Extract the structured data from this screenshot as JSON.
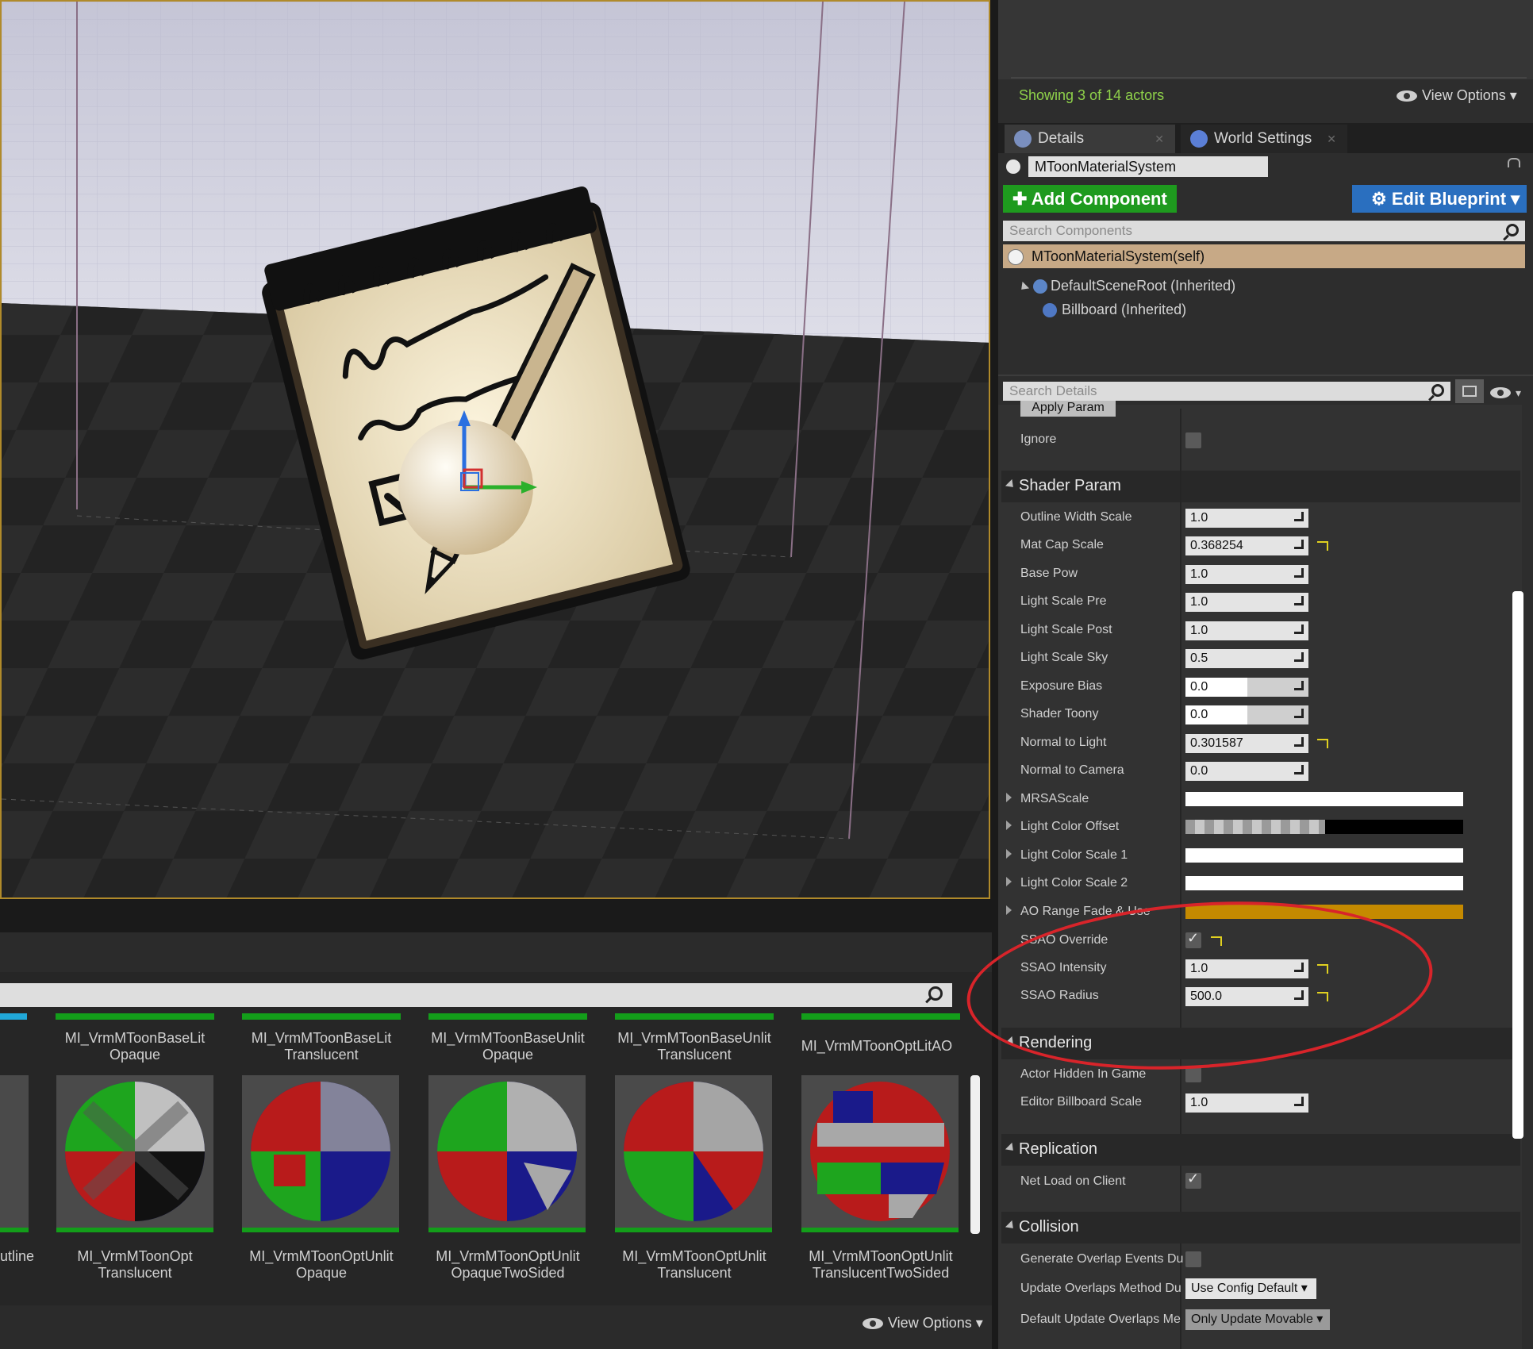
{
  "outliner": {
    "showing": "Showing 3 of 14 actors",
    "view_options": "View Options"
  },
  "tabs": [
    {
      "label": "Details"
    },
    {
      "label": "World Settings"
    }
  ],
  "actor_name": "MToonMaterialSystem",
  "buttons": {
    "add_component": "Add Component",
    "edit_blueprint": "Edit Blueprint"
  },
  "search_components_placeholder": "Search Components",
  "components": {
    "selected": "MToonMaterialSystem(self)",
    "root": "DefaultSceneRoot (Inherited)",
    "billboard": "Billboard (Inherited)"
  },
  "search_details_placeholder": "Search Details",
  "details": {
    "apply_param": "Apply Param",
    "ignore_label": "Ignore",
    "ignore_checked": false,
    "categories": {
      "shader_param": "Shader Param",
      "rendering": "Rendering",
      "replication": "Replication",
      "collision": "Collision"
    },
    "shader_params": [
      {
        "label": "Outline Width Scale",
        "value": "1.0"
      },
      {
        "label": "Mat Cap Scale",
        "value": "0.368254"
      },
      {
        "label": "Base Pow",
        "value": "1.0"
      },
      {
        "label": "Light Scale Pre",
        "value": "1.0"
      },
      {
        "label": "Light Scale Post",
        "value": "1.0"
      },
      {
        "label": "Light Scale Sky",
        "value": "0.5"
      },
      {
        "label": "Exposure Bias",
        "value": "0.0"
      },
      {
        "label": "Shader Toony",
        "value": "0.0"
      },
      {
        "label": "Normal to Light",
        "value": "0.301587"
      },
      {
        "label": "Normal to Camera",
        "value": "0.0"
      }
    ],
    "color_params": [
      {
        "label": "MRSAScale"
      },
      {
        "label": "Light Color Offset"
      },
      {
        "label": "Light Color Scale 1"
      },
      {
        "label": "Light Color Scale 2"
      },
      {
        "label": "AO Range Fade & Use"
      }
    ],
    "ssao_override_label": "SSAO Override",
    "ssao_override_checked": true,
    "ssao_intensity_label": "SSAO Intensity",
    "ssao_intensity_value": "1.0",
    "ssao_radius_label": "SSAO Radius",
    "ssao_radius_value": "500.0",
    "actor_hidden_label": "Actor Hidden In Game",
    "editor_billboard_label": "Editor Billboard Scale",
    "editor_billboard_value": "1.0",
    "net_load_label": "Net Load on Client",
    "gen_overlap_label": "Generate Overlap Events Du",
    "update_overlaps_label": "Update Overlaps Method Du",
    "update_overlaps_value": "Use Config Default",
    "default_update_label": "Default Update Overlaps Me",
    "default_update_value": "Only Update Movable"
  },
  "content_browser": {
    "view_options": "View Options",
    "row1_names": [
      [
        "MI_VrmMToonBaseLit",
        "Opaque"
      ],
      [
        "MI_VrmMToonBaseLit",
        "Translucent"
      ],
      [
        "MI_VrmMToonBaseUnlit",
        "Opaque"
      ],
      [
        "MI_VrmMToonBaseUnlit",
        "Translucent"
      ],
      [
        "MI_VrmMToonOptLitAO",
        ""
      ]
    ],
    "row2_partial": "utline",
    "row2_names": [
      [
        "MI_VrmMToonOpt",
        "Translucent"
      ],
      [
        "MI_VrmMToonOptUnlit",
        "Opaque"
      ],
      [
        "MI_VrmMToonOptUnlit",
        "OpaqueTwoSided"
      ],
      [
        "MI_VrmMToonOptUnlit",
        "Translucent"
      ],
      [
        "MI_VrmMToonOptUnlit",
        "TranslucentTwoSided"
      ]
    ]
  },
  "colors": {
    "selected_component": "#c7a986",
    "add_component": "#1e9a1e",
    "edit_blueprint": "#2a6fbf",
    "showing_text": "#8fd24a",
    "annotation": "#d8242a",
    "ao_bar": "#c58a00"
  }
}
